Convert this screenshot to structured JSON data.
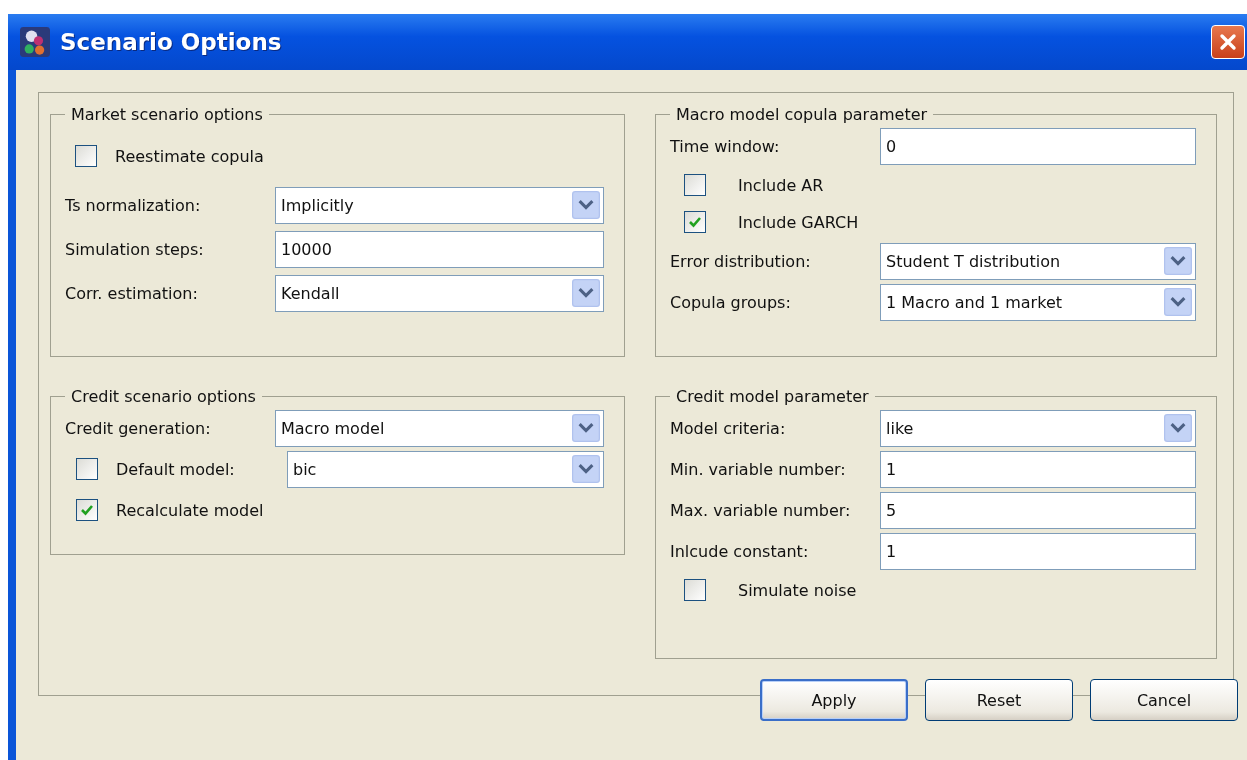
{
  "window": {
    "title": "Scenario Options"
  },
  "columns": [
    {
      "groups": [
        {
          "title": "Market scenario options",
          "rows": [
            {
              "kind": "checkbox",
              "label": "Reestimate copula",
              "checked": false
            },
            {
              "kind": "dropdown",
              "label": "Ts normalization:",
              "value": "Implicitly"
            },
            {
              "kind": "text",
              "label": "Simulation steps:",
              "value": "10000"
            },
            {
              "kind": "dropdown",
              "label": "Corr. estimation:",
              "value": "Kendall"
            }
          ]
        },
        {
          "title": "Credit scenario options",
          "rows": [
            {
              "kind": "dropdown",
              "label": "Credit generation:",
              "value": "Macro model"
            },
            {
              "kind": "checkdrop",
              "label": "Default model:",
              "checked": false,
              "value": "bic"
            },
            {
              "kind": "checkbox",
              "label": "Recalculate model",
              "checked": true
            }
          ]
        }
      ]
    },
    {
      "groups": [
        {
          "title": "Macro model copula parameter",
          "rows": [
            {
              "kind": "text",
              "label": "Time window:",
              "value": "0"
            },
            {
              "kind": "checkbox",
              "label": "Include AR",
              "checked": false
            },
            {
              "kind": "checkbox",
              "label": "Include GARCH",
              "checked": true
            },
            {
              "kind": "dropdown",
              "label": "Error distribution:",
              "value": "Student T distribution"
            },
            {
              "kind": "dropdown",
              "label": "Copula groups:",
              "value": "1 Macro and 1 market"
            }
          ]
        },
        {
          "title": "Credit model parameter",
          "rows": [
            {
              "kind": "dropdown",
              "label": "Model criteria:",
              "value": "like"
            },
            {
              "kind": "text",
              "label": "Min. variable number:",
              "value": "1"
            },
            {
              "kind": "text",
              "label": "Max. variable number:",
              "value": "5"
            },
            {
              "kind": "text",
              "label": "Inlcude constant:",
              "value": "1"
            },
            {
              "kind": "checkbox",
              "label": "Simulate noise",
              "checked": false
            }
          ]
        }
      ]
    }
  ],
  "buttons": [
    {
      "label": "Apply",
      "default": true
    },
    {
      "label": "Reset",
      "default": false
    },
    {
      "label": "Cancel",
      "default": false
    }
  ]
}
